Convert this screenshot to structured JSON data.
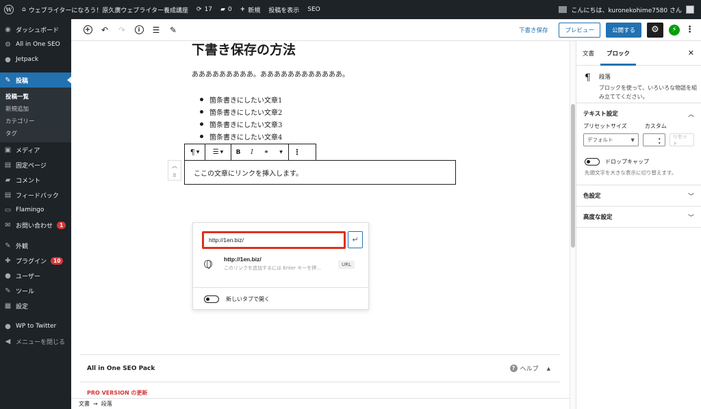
{
  "admin_bar": {
    "site_name": "ウェブライターになろう！原久廣ウェブライター養成講座",
    "updates_count": "17",
    "comments_count": "0",
    "new_label": "新規",
    "view_post_label": "投稿を表示",
    "seo_label": "SEO",
    "greeting": "こんにちは、kuronekohime7580 さん"
  },
  "sidebar": {
    "items": [
      {
        "label": "ダッシュボード",
        "icon": "◉"
      },
      {
        "label": "All in One SEO",
        "icon": "⚙"
      },
      {
        "label": "Jetpack",
        "icon": "●"
      },
      {
        "label": "投稿",
        "icon": "✎"
      },
      {
        "label": "メディア",
        "icon": "▣"
      },
      {
        "label": "固定ページ",
        "icon": "▤"
      },
      {
        "label": "コメント",
        "icon": "▰"
      },
      {
        "label": "フィードバック",
        "icon": "▤"
      },
      {
        "label": "Flamingo",
        "icon": "▭"
      },
      {
        "label": "お問い合わせ",
        "icon": "✉",
        "badge": "1"
      },
      {
        "label": "外観",
        "icon": "✎"
      },
      {
        "label": "プラグイン",
        "icon": "✚",
        "badge": "10"
      },
      {
        "label": "ユーザー",
        "icon": "●"
      },
      {
        "label": "ツール",
        "icon": "✎"
      },
      {
        "label": "設定",
        "icon": "▦"
      },
      {
        "label": "WP to Twitter",
        "icon": "●"
      },
      {
        "label": "メニューを閉じる",
        "icon": "◀"
      }
    ],
    "submenu": [
      "投稿一覧",
      "新規追加",
      "カテゴリー",
      "タグ"
    ]
  },
  "toolbar": {
    "save_draft": "下書き保存",
    "preview": "プレビュー",
    "publish": "公開する"
  },
  "editor": {
    "title": "下書き保存の方法",
    "paragraph1": "あああああああああ。ああああああああああああ。",
    "bullets": [
      "箇条書きにしたい文章1",
      "箇条書きにしたい文章2",
      "箇条書きにしたい文章3",
      "箇条書きにしたい文章4"
    ],
    "paragraph2": "ここの文章にリンクを挿入します。"
  },
  "link_popover": {
    "url_value": "http://1en.biz/",
    "suggestion_title": "http://1en.biz/",
    "suggestion_desc": "このリンクを追加するには Enter キーを押...",
    "suggestion_type": "URL",
    "new_tab_label": "新しいタブで開く"
  },
  "seo_box": {
    "title": "All in One SEO Pack",
    "help": "ヘルプ",
    "pro_banner": "PRO VERSION の更新"
  },
  "breadcrumb": {
    "root": "文書",
    "arrow": "→",
    "current": "段落"
  },
  "settings_panel": {
    "tab_document": "文書",
    "tab_block": "ブロック",
    "block_name": "段落",
    "block_desc": "ブロックを使って、いろいろな物語を組み立ててください。",
    "text_settings": "テキスト設定",
    "preset_size_label": "プリセットサイズ",
    "custom_label": "カスタム",
    "preset_value": "デフォルト",
    "reset": "リセット",
    "drop_cap": "ドロップキャップ",
    "drop_cap_help": "先頭文字を大きな表示に切り替えます。",
    "color_settings": "色設定",
    "advanced_settings": "高度な設定"
  },
  "colors": {
    "accent": "#2271b1",
    "highlight_border": "#e02e1c",
    "admin_dark": "#1d2327"
  }
}
